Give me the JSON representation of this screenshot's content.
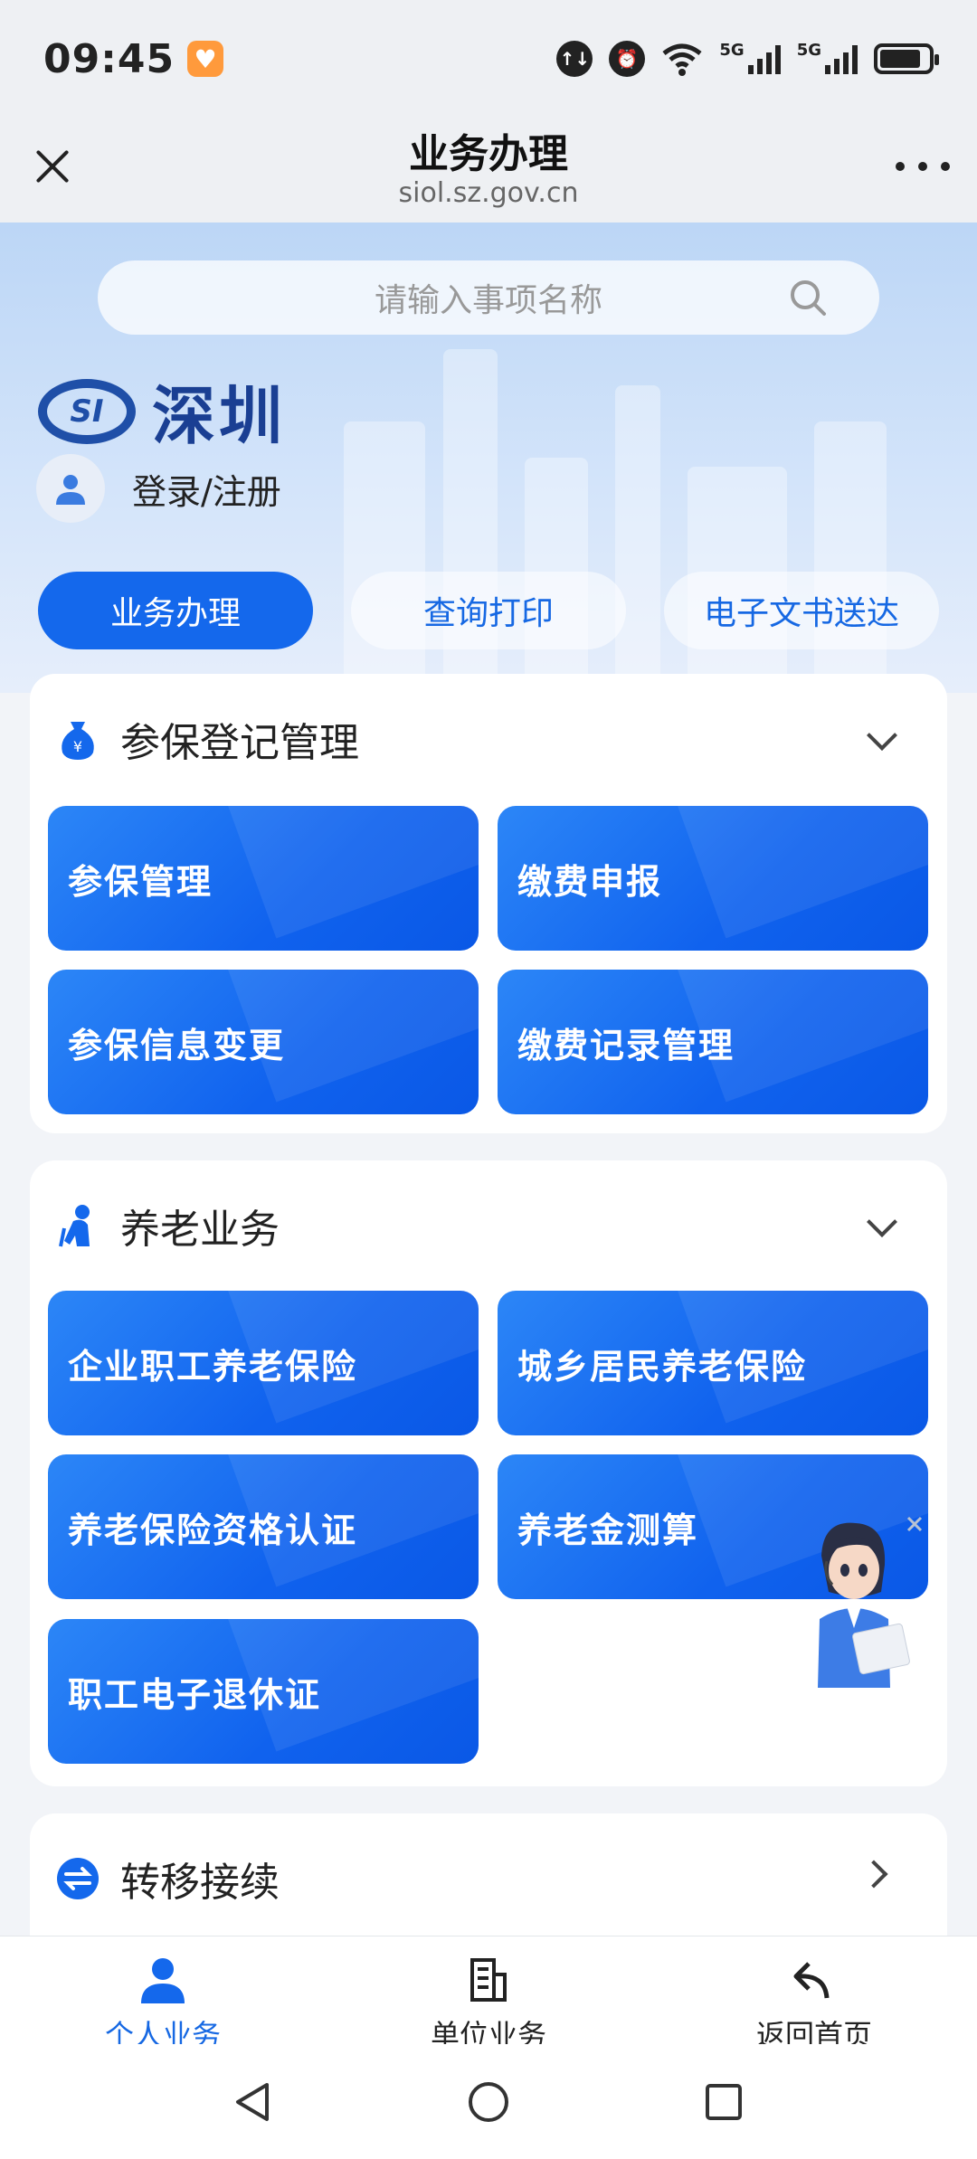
{
  "status_bar": {
    "time": "09:45",
    "network_1": "5G",
    "network_2": "5G",
    "battery_level": 0.85
  },
  "title_bar": {
    "title": "业务办理",
    "url": "siol.sz.gov.cn"
  },
  "hero": {
    "search_placeholder": "请输入事项名称",
    "logo_mark": "SI",
    "logo_text": "深圳",
    "login_text": "登录/注册",
    "tabs": [
      "业务办理",
      "查询打印",
      "电子文书送达"
    ]
  },
  "sections": {
    "insurance": {
      "title": "参保登记管理",
      "tiles": [
        "参保管理",
        "缴费申报",
        "参保信息变更",
        "缴费记录管理"
      ]
    },
    "pension": {
      "title": "养老业务",
      "tiles": [
        "企业职工养老保险",
        "城乡居民养老保险",
        "养老保险资格认证",
        "养老金测算",
        "职工电子退休证"
      ]
    },
    "transfer": {
      "title": "转移接续"
    }
  },
  "bottom_nav": {
    "items": [
      "个人业务",
      "单位业务",
      "返回首页"
    ]
  },
  "colors": {
    "primary": "#1468ec",
    "logo": "#1a3f93",
    "active_nav": "#1668e3"
  },
  "icons": [
    "close-icon",
    "more-icon",
    "search-icon",
    "user-icon",
    "money-bag-icon",
    "elderly-icon",
    "transfer-icon",
    "person-icon",
    "document-icon",
    "return-icon"
  ]
}
